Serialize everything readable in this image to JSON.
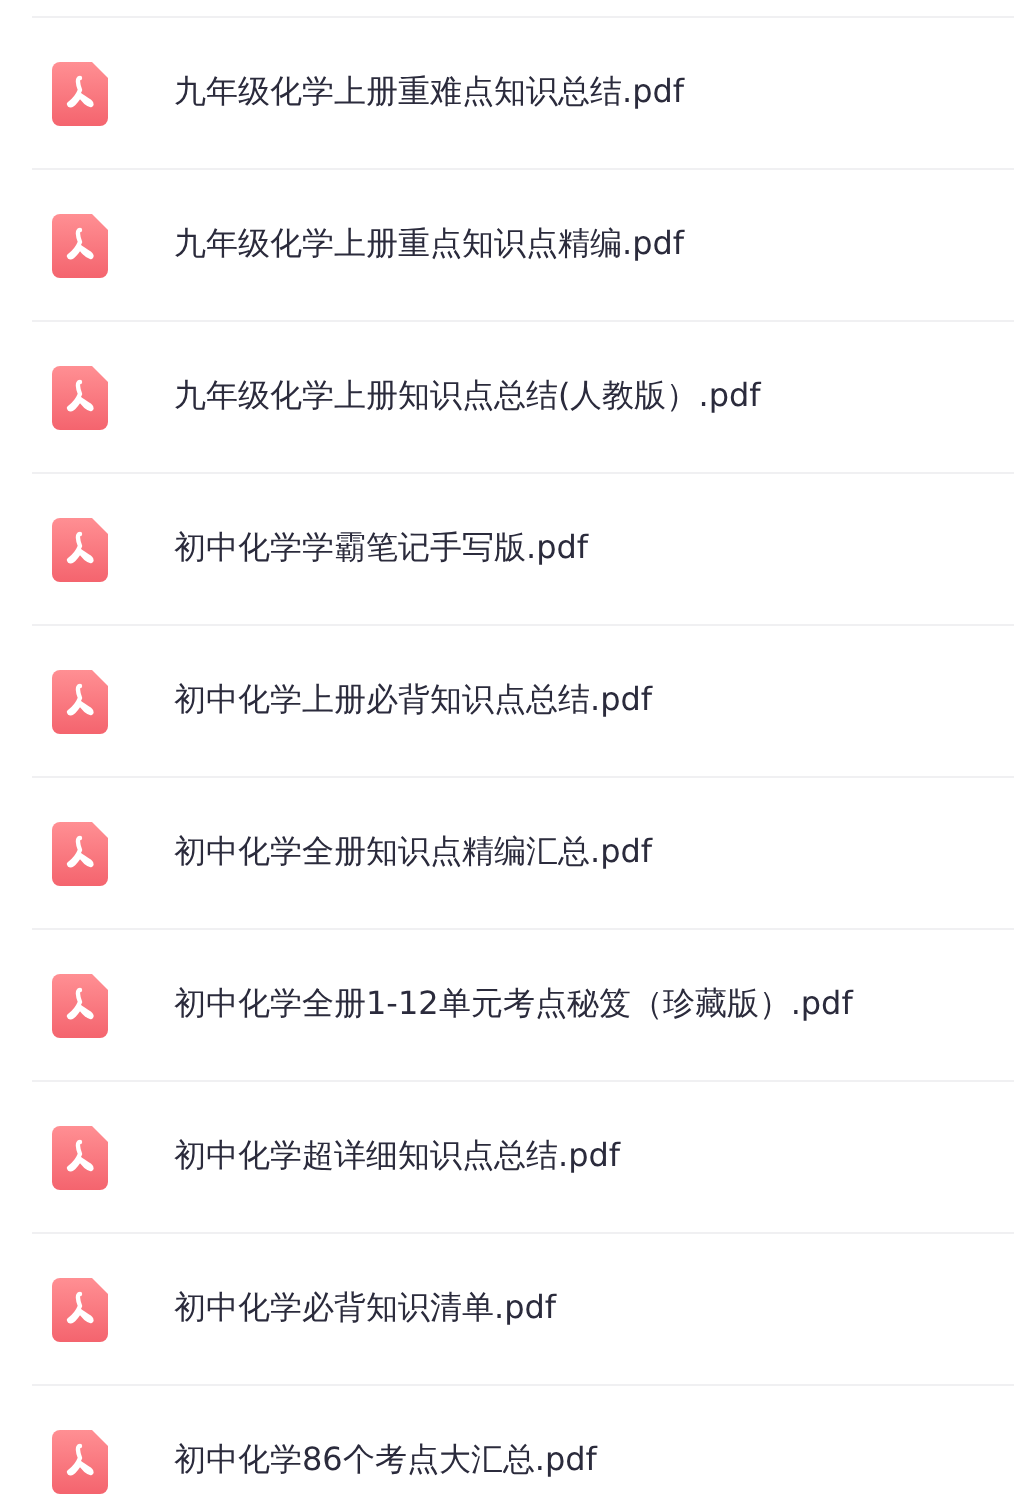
{
  "files": [
    {
      "name": "九年级化学上册重难点知识总结.pdf",
      "kind": "document"
    },
    {
      "name": "九年级化学上册重点知识点精编.pdf",
      "kind": "document"
    },
    {
      "name": "九年级化学上册知识点总结(人教版）.pdf",
      "kind": "document"
    },
    {
      "name": "初中化学学霸笔记手写版.pdf",
      "kind": "document"
    },
    {
      "name": "初中化学上册必背知识点总结.pdf",
      "kind": "document"
    },
    {
      "name": "初中化学全册知识点精编汇总.pdf",
      "kind": "document"
    },
    {
      "name": "初中化学全册1-12单元考点秘笈（珍藏版）.pdf",
      "kind": "document"
    },
    {
      "name": "初中化学超详细知识点总结.pdf",
      "kind": "document"
    },
    {
      "name": "初中化学必背知识清单.pdf",
      "kind": "document"
    },
    {
      "name": "初中化学86个考点大汇总.pdf",
      "kind": "document"
    }
  ]
}
